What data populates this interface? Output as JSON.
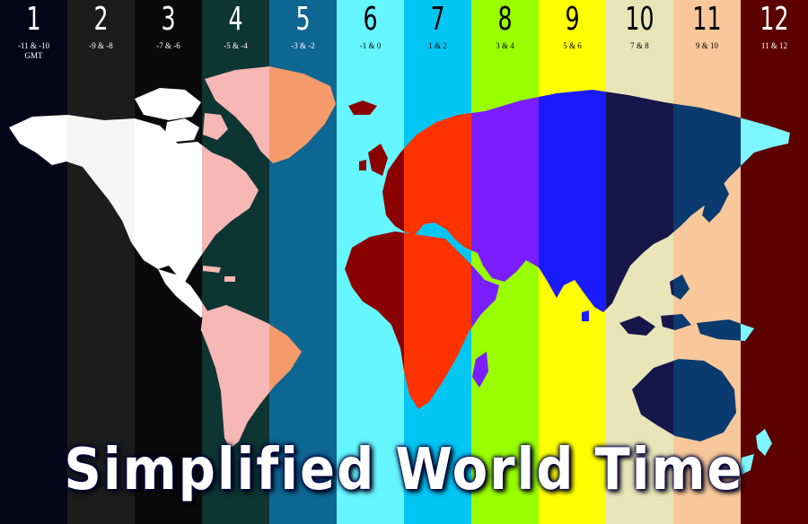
{
  "title": "Simplified World Time",
  "zones": [
    {
      "number": "1",
      "offset": "-11 & -10\nGMT",
      "color": "#05051a",
      "text_color": "#ffffff",
      "land_color": "#ffffff"
    },
    {
      "number": "2",
      "offset": "-9 & -8",
      "color": "#1c1c1c",
      "text_color": "#ffffff",
      "land_color": "#f5f5f5"
    },
    {
      "number": "3",
      "offset": "-7 & -6",
      "color": "#0a0a0a",
      "text_color": "#ffffff",
      "land_color": "#ffffff"
    },
    {
      "number": "4",
      "offset": "-5 & -4",
      "color": "#0d3533",
      "text_color": "#ffffff",
      "land_color": "#f7b7b4"
    },
    {
      "number": "5",
      "offset": "-3 & -2",
      "color": "#0e6692",
      "text_color": "#ffffff",
      "land_color": "#f59a6b"
    },
    {
      "number": "6",
      "offset": "-1 & 0",
      "color": "#66f6ff",
      "text_color": "#000000",
      "land_color": "#8a0000"
    },
    {
      "number": "7",
      "offset": "1 & 2",
      "color": "#00c6f4",
      "text_color": "#000000",
      "land_color": "#ff3300"
    },
    {
      "number": "8",
      "offset": "3 & 4",
      "color": "#99ff00",
      "text_color": "#000000",
      "land_color": "#7a1dff"
    },
    {
      "number": "9",
      "offset": "5 & 6",
      "color": "#ffff00",
      "text_color": "#000000",
      "land_color": "#1a1aff"
    },
    {
      "number": "10",
      "offset": "7 & 8",
      "color": "#e9e5b9",
      "text_color": "#000000",
      "land_color": "#16164a"
    },
    {
      "number": "11",
      "offset": "9 & 10",
      "color": "#f8c89a",
      "text_color": "#000000",
      "land_color": "#0a3a6e"
    },
    {
      "number": "12",
      "offset": "11 & 12",
      "color": "#5c0000",
      "text_color": "#ffffff",
      "land_color": "#7ef6ff"
    }
  ]
}
